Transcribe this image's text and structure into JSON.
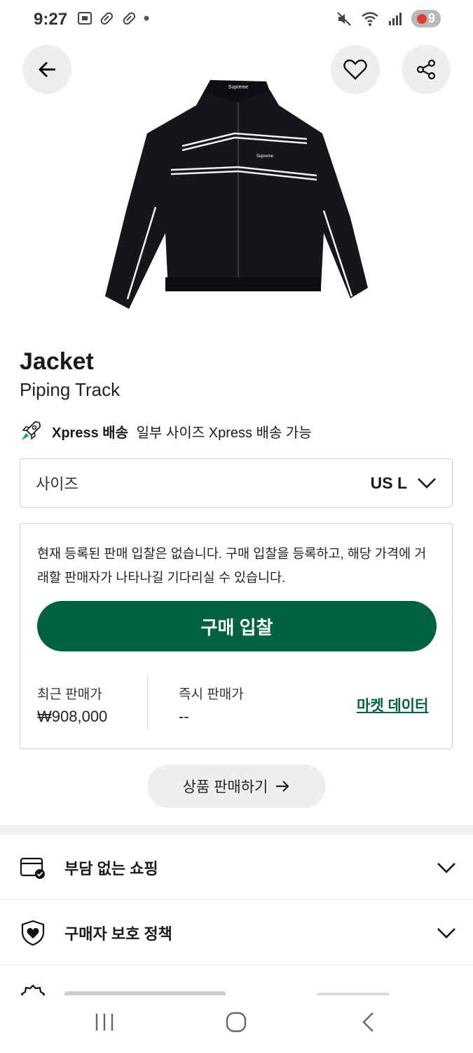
{
  "status_bar": {
    "time": "9:27",
    "battery": "9"
  },
  "icons": {
    "back": "arrow-left-icon",
    "wishlist": "heart-icon",
    "share": "share-icon",
    "xpress": "rocket-icon",
    "size_dropdown": "chevron-down-icon",
    "sell_arrow": "arrow-right-icon",
    "shopping": "shopping-check-icon",
    "protection": "shield-heart-icon"
  },
  "product": {
    "title": "Jacket",
    "subtitle": "Piping Track",
    "image_logo_text": "Supreme"
  },
  "xpress": {
    "label": "Xpress 배송",
    "description": "일부 사이즈 Xpress 배송 가능"
  },
  "size": {
    "label": "사이즈",
    "value": "US L"
  },
  "bid": {
    "notice": "현재 등록된 판매 입찰은 없습니다. 구매 입찰을 등록하고, 해당 가격에 거래할 판매자가 나타나길 기다리실 수 있습니다.",
    "button_label": "구매 입찰",
    "last_sale_label": "최근 판매가",
    "last_sale_value": "₩908,000",
    "instant_sale_label": "즉시 판매가",
    "instant_sale_value": "--",
    "market_data_label": "마켓 데이터"
  },
  "sell_button_label": "상품 판매하기",
  "accordion": [
    {
      "label": "부담 없는 쇼핑"
    },
    {
      "label": "구매자 보호 정책"
    }
  ],
  "colors": {
    "brand_green": "#006340",
    "page_bg": "#ffffff",
    "button_bg": "#eeeeee"
  }
}
